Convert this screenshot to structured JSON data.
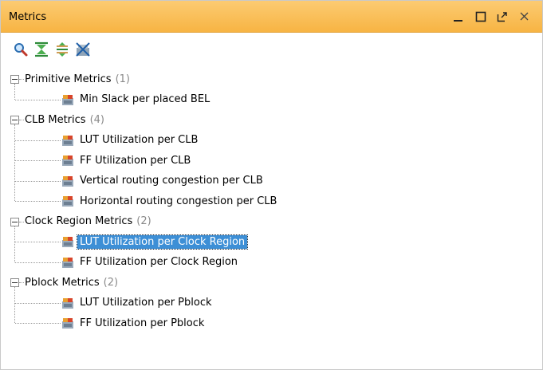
{
  "panel": {
    "title": "Metrics",
    "controls": [
      "minimize",
      "maximize",
      "float",
      "close"
    ]
  },
  "toolbar": {
    "buttons": [
      {
        "icon": "search-icon"
      },
      {
        "icon": "collapse-all-icon"
      },
      {
        "icon": "expand-all-icon"
      },
      {
        "icon": "clear-metrics-icon"
      }
    ]
  },
  "tree": {
    "groups": [
      {
        "label": "Primitive Metrics",
        "count": "(1)",
        "items": [
          "Min Slack per placed BEL"
        ]
      },
      {
        "label": "CLB Metrics",
        "count": "(4)",
        "items": [
          "LUT Utilization per CLB",
          "FF Utilization per CLB",
          "Vertical routing congestion per CLB",
          "Horizontal routing congestion per CLB"
        ]
      },
      {
        "label": "Clock Region Metrics",
        "count": "(2)",
        "items": [
          "LUT Utilization per Clock Region",
          "FF Utilization per Clock Region"
        ]
      },
      {
        "label": "Pblock Metrics",
        "count": "(2)",
        "items": [
          "LUT Utilization per Pblock",
          "FF Utilization per Pblock"
        ]
      }
    ],
    "selected": "LUT Utilization per Clock Region"
  },
  "colors": {
    "title_bar": "#f7b443",
    "selection": "#3d8fd6",
    "count_text": "#8a8a8a"
  }
}
